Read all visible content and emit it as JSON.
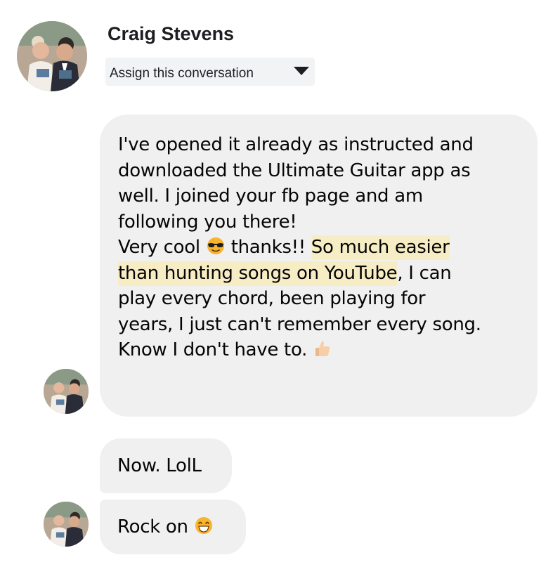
{
  "contact": {
    "name": "Craig Stevens",
    "assign_label": "Assign this conversation",
    "avatar_icon": "user-avatar-photo",
    "dropdown_icon": "caret-down-icon"
  },
  "messages": [
    {
      "lines": [
        "I've opened it already as instructed and",
        "downloaded the Ultimate Guitar app as",
        "well. I joined your fb page and am",
        "following you there!"
      ],
      "line5_before": "Very cool",
      "line5_emoji": "sunglasses-emoji",
      "line5_middle": "thanks!!",
      "highlight_part1": "So much easier",
      "highlight_part2": "than hunting songs on YouTube",
      "line6_after": ", I can",
      "lines_after": [
        "play every chord, been playing for",
        "years, I just can't remember every song."
      ],
      "last_line": "Know I don't have to.",
      "last_emoji": "thumbs-up-emoji"
    },
    {
      "text": "Now. LolL"
    },
    {
      "text": "Rock on",
      "emoji": "grinning-emoji"
    }
  ],
  "colors": {
    "bubble": "#f0f0f0",
    "highlight": "#f7edc5",
    "assign_bg": "#f2f3f5",
    "text": "#050505"
  }
}
